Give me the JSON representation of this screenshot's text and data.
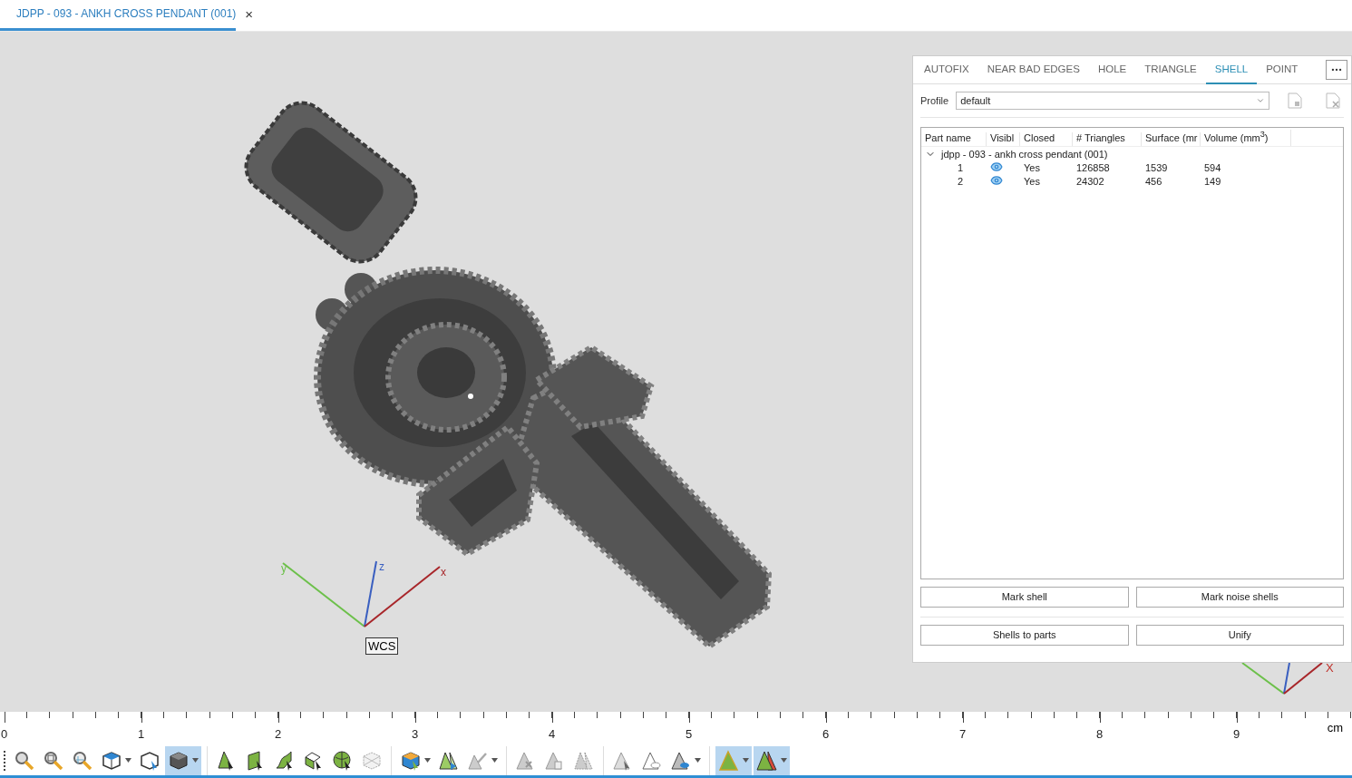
{
  "document_tab": {
    "title": "JDPP - 093 - ANKH CROSS PENDANT (001)",
    "close": "×",
    "selected": true
  },
  "viewport": {
    "axes": {
      "x": "x",
      "y": "y",
      "z": "z",
      "frame": "WCS"
    },
    "corner_axes": {
      "x": "X"
    }
  },
  "panel": {
    "tabs": [
      {
        "label": "AUTOFIX",
        "selected": false
      },
      {
        "label": "NEAR BAD EDGES",
        "selected": false
      },
      {
        "label": "HOLE",
        "selected": false
      },
      {
        "label": "TRIANGLE",
        "selected": false
      },
      {
        "label": "SHELL",
        "selected": true
      },
      {
        "label": "POINT",
        "selected": false
      }
    ],
    "profile": {
      "label": "Profile",
      "value": "default"
    },
    "table": {
      "columns": [
        "Part name",
        "Visibl",
        "Closed",
        "# Triangles",
        "Surface (mr",
        "Volume (mm$^{3}$)"
      ],
      "groups": [
        {
          "name": "jdpp - 093 - ankh cross pendant (001)",
          "expanded": true,
          "children": [
            {
              "id": "1",
              "visible": true,
              "closed": "Yes",
              "triangles": "126858",
              "surface": "1539",
              "volume": "594"
            },
            {
              "id": "2",
              "visible": true,
              "closed": "Yes",
              "triangles": "24302",
              "surface": "456",
              "volume": "149"
            }
          ]
        }
      ]
    },
    "buttons": [
      [
        "Mark shell",
        "Mark noise shells"
      ],
      [
        "Shells to parts",
        "Unify"
      ]
    ]
  },
  "ruler": {
    "labels": [
      "0",
      "1",
      "2",
      "3",
      "4",
      "5",
      "6",
      "7",
      "8",
      "9"
    ],
    "unit": "cm"
  },
  "toolbar": {
    "groups": [
      {
        "tools": [
          {
            "selected": false,
            "dropdown": false
          },
          {
            "selected": false,
            "dropdown": false
          },
          {
            "selected": false,
            "dropdown": false
          },
          {
            "selected": false,
            "dropdown": true
          },
          {
            "selected": false,
            "dropdown": false
          },
          {
            "selected": true,
            "dropdown": true
          }
        ]
      },
      {
        "tools": [
          {
            "selected": false,
            "dropdown": false
          },
          {
            "selected": false,
            "dropdown": false
          },
          {
            "selected": false,
            "dropdown": false
          },
          {
            "selected": false,
            "dropdown": false
          },
          {
            "selected": false,
            "dropdown": false
          },
          {
            "selected": false,
            "dropdown": false
          }
        ]
      },
      {
        "tools": [
          {
            "selected": false,
            "dropdown": true
          },
          {
            "selected": false,
            "dropdown": false
          },
          {
            "selected": false,
            "dropdown": true
          }
        ]
      },
      {
        "tools": [
          {
            "selected": false,
            "dropdown": false
          },
          {
            "selected": false,
            "dropdown": false
          },
          {
            "selected": false,
            "dropdown": false
          }
        ]
      },
      {
        "tools": [
          {
            "selected": false,
            "dropdown": false
          },
          {
            "selected": false,
            "dropdown": false
          },
          {
            "selected": false,
            "dropdown": true
          }
        ]
      },
      {
        "tools": [
          {
            "selected": true,
            "dropdown": true
          },
          {
            "selected": true,
            "dropdown": true
          }
        ]
      }
    ]
  }
}
